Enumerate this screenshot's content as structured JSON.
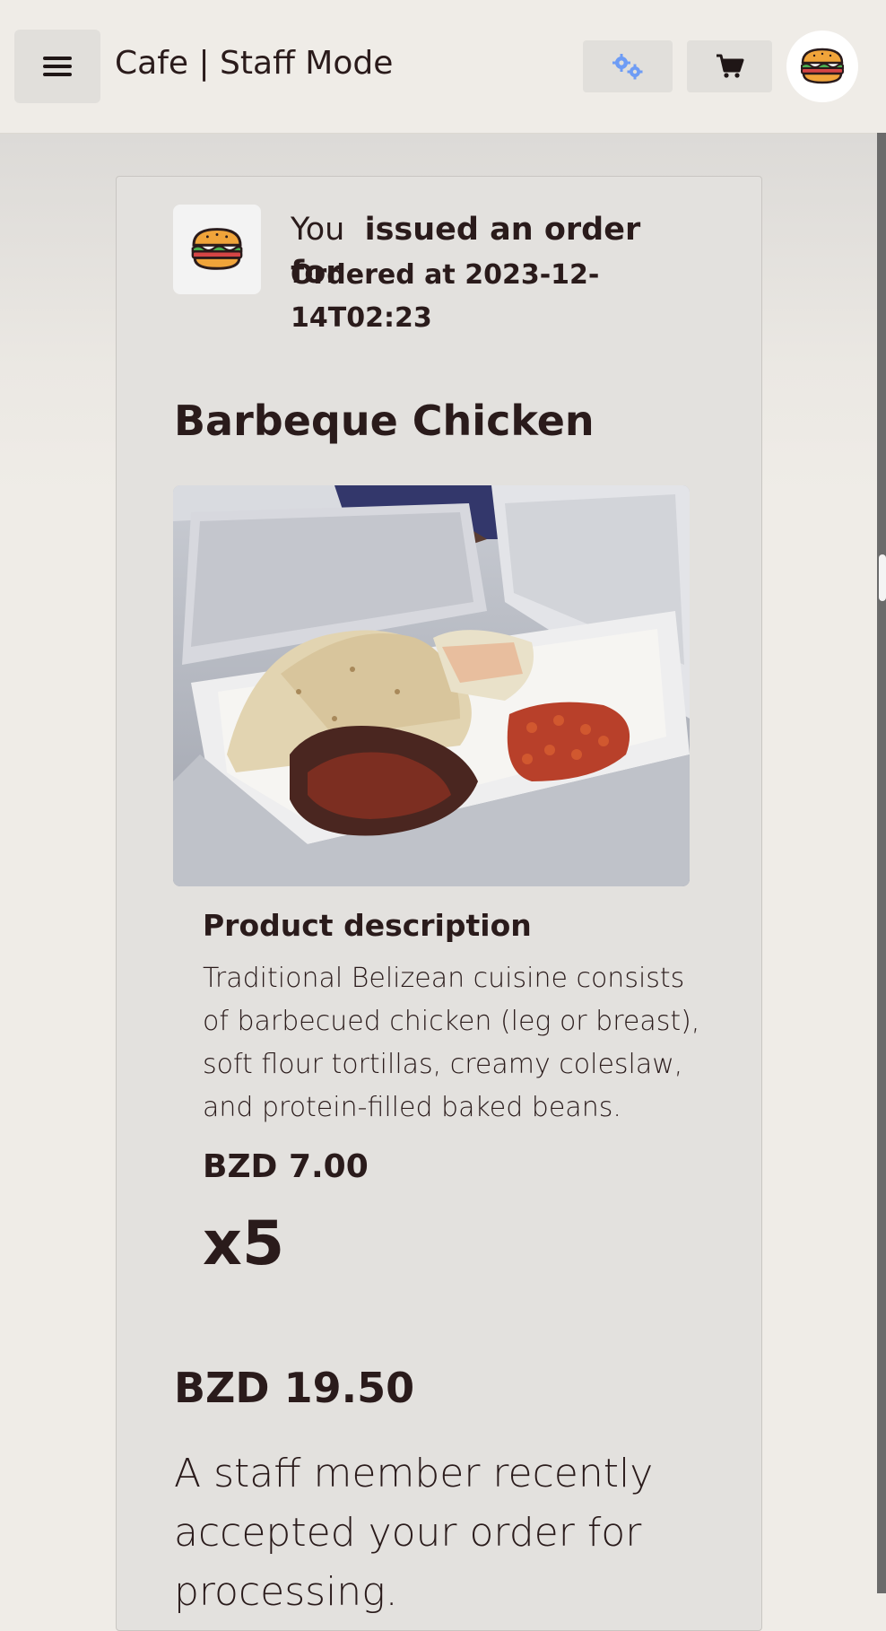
{
  "header": {
    "title": "Cafe | Staff Mode",
    "menu_icon": "hamburger-menu-icon",
    "admin_icon": "gears-icon",
    "cart_icon": "shopping-cart-icon",
    "avatar_icon": "burger-icon",
    "admin_icon_color": "#6e9cf5"
  },
  "order": {
    "notice_you": "You",
    "notice_rest": "issued an order for",
    "ordered_at": "Ordered at 2023-12-14T02:23",
    "product_name": "Barbeque Chicken",
    "photo": "barbeque-chicken-meal-photo",
    "description_heading": "Product description",
    "description": "Traditional Belizean cuisine consists of barbecued chicken (leg or breast), soft flour tortillas, creamy coleslaw, and protein-filled baked beans.",
    "unit_price": "BZD 7.00",
    "quantity": "x5",
    "total": "BZD 19.50",
    "status_message": "A staff member recently accepted your order for processing."
  }
}
